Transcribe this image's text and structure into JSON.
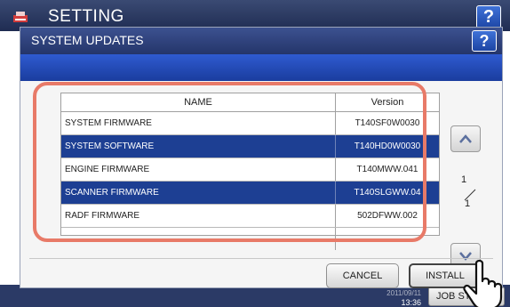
{
  "background_window": {
    "title": "SETTING",
    "help_label": "?",
    "datetime_date": "2011/09/11",
    "datetime_time": "13:36",
    "job_status_label": "JOB STATUS"
  },
  "dialog": {
    "title": "SYSTEM UPDATES",
    "help_label": "?"
  },
  "table": {
    "columns": {
      "name": "NAME",
      "version": "Version"
    },
    "rows": [
      {
        "name": "SYSTEM FIRMWARE",
        "version": "T140SF0W0030",
        "selected": false
      },
      {
        "name": "SYSTEM SOFTWARE",
        "version": "T140HD0W0030",
        "selected": true
      },
      {
        "name": "ENGINE FIRMWARE",
        "version": "T140MWW.041",
        "selected": false
      },
      {
        "name": "SCANNER FIRMWARE",
        "version": "T140SLGWW.04",
        "selected": true
      },
      {
        "name": "RADF FIRMWARE",
        "version": "502DFWW.002",
        "selected": false
      },
      {
        "name": "",
        "version": "",
        "selected": false
      }
    ]
  },
  "pagination": {
    "current": "1",
    "total": "1"
  },
  "buttons": {
    "cancel": "CANCEL",
    "install": "INSTALL"
  },
  "colors": {
    "selected_row": "#1d3f93",
    "highlight_outline": "#e87a68",
    "title_bar": "#24356a",
    "accent_band": "#2f5bd0"
  },
  "icons": [
    "printer-logo-icon",
    "help-icon",
    "chevron-up-icon",
    "chevron-down-icon",
    "hand-pointer-icon"
  ]
}
